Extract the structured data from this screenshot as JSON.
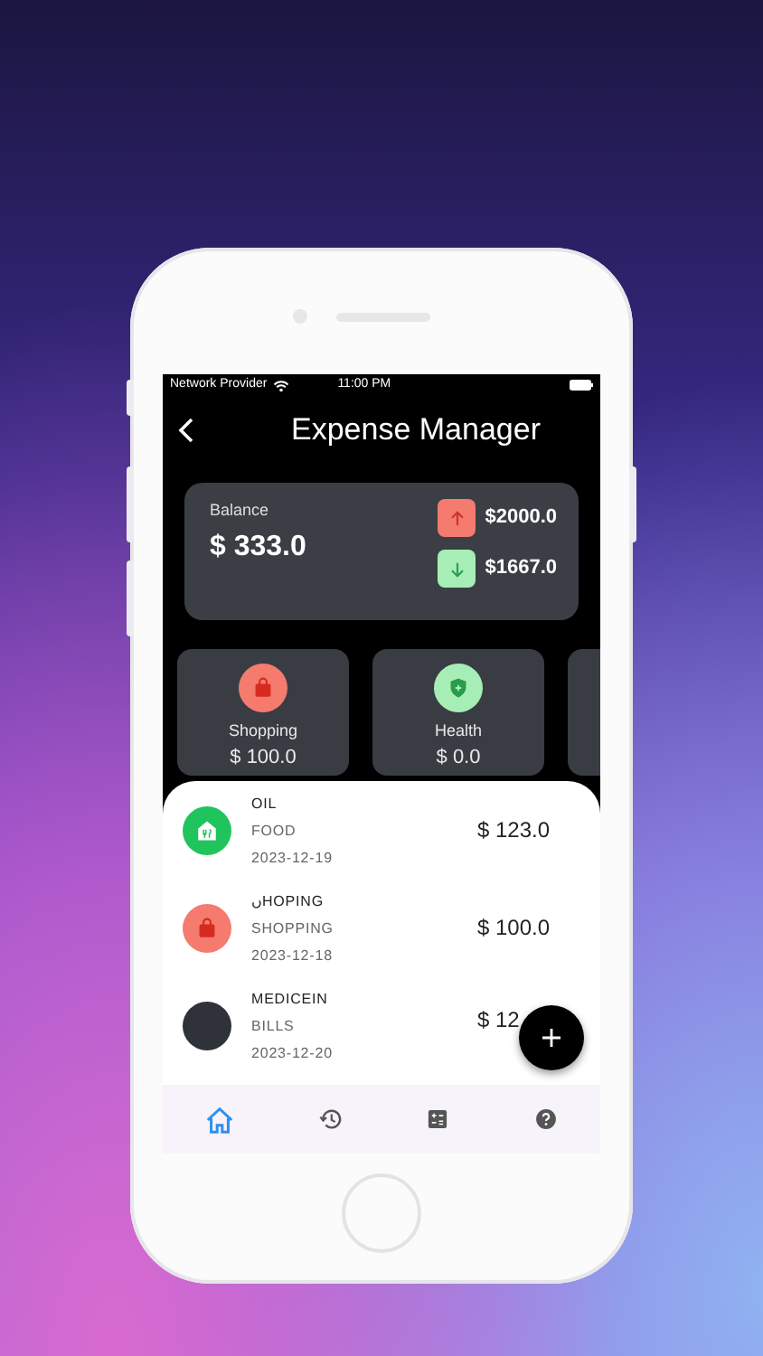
{
  "status_bar": {
    "carrier": "Network Provider",
    "time": "11:00 PM"
  },
  "header": {
    "title": "Expense Manager"
  },
  "balance": {
    "label": "Balance",
    "amount": "$ 333.0",
    "income": "$2000.0",
    "expense": "$1667.0"
  },
  "categories": [
    {
      "kind": "bag",
      "color": "#f47b6e",
      "name": "Shopping",
      "amount": "$ 100.0"
    },
    {
      "kind": "shield",
      "color": "#a6eeb6",
      "name": "Health",
      "amount": "$ 0.0"
    }
  ],
  "transactions": [
    {
      "kind": "food",
      "color": "#1fc45c",
      "title": "OIL",
      "category": "FOOD",
      "date": "2023-12-19",
      "amount": "$ 123.0"
    },
    {
      "kind": "bag",
      "color": "#f47b6e",
      "title": "ںHOPING",
      "category": "SHOPPING",
      "date": "2023-12-18",
      "amount": "$ 100.0"
    },
    {
      "kind": "blank",
      "color": "#2f3238",
      "title": "MEDICEIN",
      "category": "BILLS",
      "date": "2023-12-20",
      "amount": "$ 12"
    }
  ],
  "bottom_nav": [
    {
      "kind": "home",
      "selected": true
    },
    {
      "kind": "history",
      "selected": false
    },
    {
      "kind": "calculator",
      "selected": false
    },
    {
      "kind": "help",
      "selected": false
    }
  ]
}
